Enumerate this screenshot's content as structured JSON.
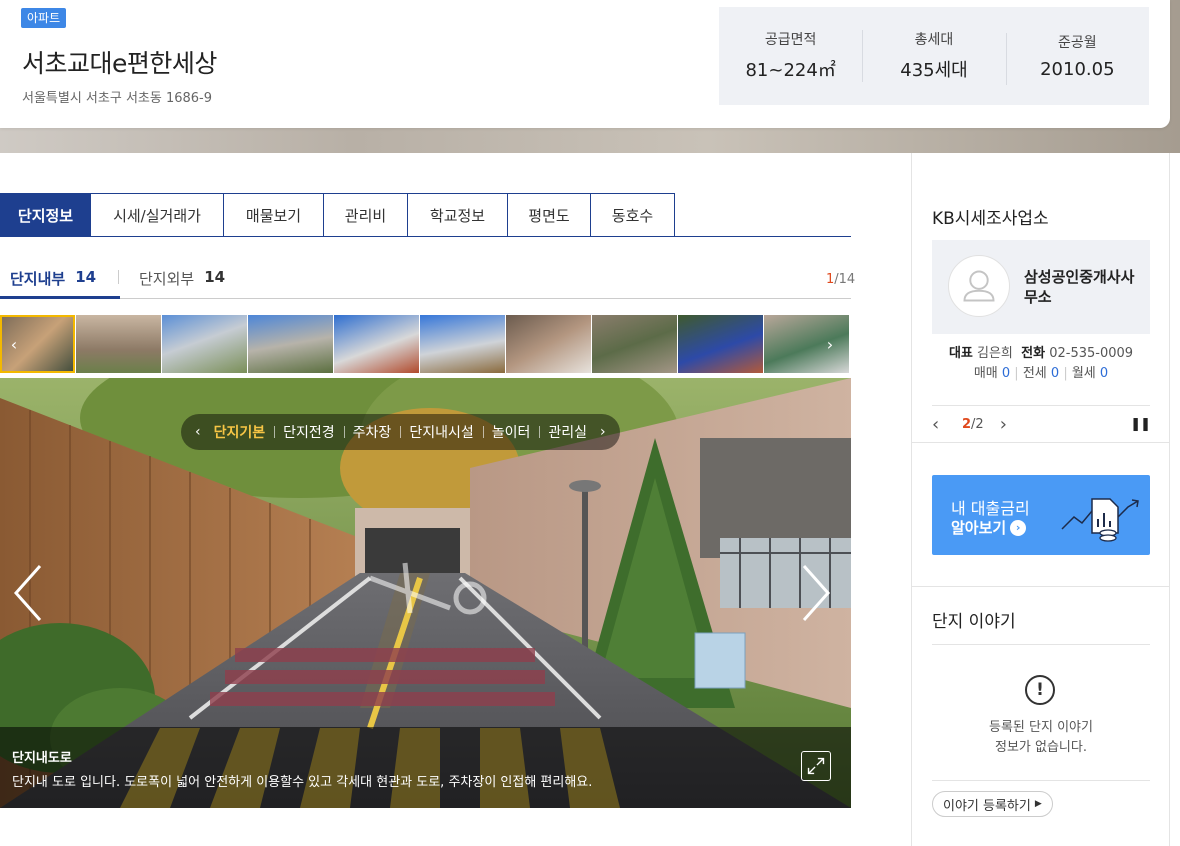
{
  "header": {
    "badge": "아파트",
    "name": "서초교대e편한세상",
    "address": "서울특별시 서초구 서초동 1686-9",
    "stats": [
      {
        "label": "공급면적",
        "value": "81~224㎡"
      },
      {
        "label": "총세대",
        "value": "435세대"
      },
      {
        "label": "준공월",
        "value": "2010.05"
      }
    ]
  },
  "tabs": [
    "단지정보",
    "시세/실거래가",
    "매물보기",
    "관리비",
    "학교정보",
    "평면도",
    "동호수"
  ],
  "subtabs": {
    "inner": {
      "label": "단지내부",
      "count": "14"
    },
    "outer": {
      "label": "단지외부",
      "count": "14"
    }
  },
  "counter": {
    "current": "1",
    "total": "/14"
  },
  "photo": {
    "categories": [
      "단지기본",
      "단지전경",
      "주차장",
      "단지내시설",
      "놀이터",
      "관리실"
    ],
    "caption_title": "단지내도로",
    "caption_desc": "단지내 도로 입니다. 도로폭이 넓어 안전하게 이용할수 있고 각세대 현관과 도로, 주차장이 인접해 편리해요."
  },
  "right_panel": {
    "title": "KB시세조사업소",
    "agent_name": "삼성공인중개사사무소",
    "rep_label": "대표",
    "rep_name": "김은희",
    "phone_label": "전화",
    "phone": "02-535-0009",
    "sale_label": "매매",
    "sale_count": "0",
    "jeonse_label": "전세",
    "jeonse_count": "0",
    "monthly_label": "월세",
    "monthly_count": "0",
    "pager_current": "2",
    "pager_total": "/2",
    "loan_line1": "내 대출금리",
    "loan_line2": "알아보기",
    "story_title": "단지 이야기",
    "story_empty_line1": "등록된 단지 이야기",
    "story_empty_line2": "정보가 없습니다.",
    "story_button": "이야기 등록하기"
  },
  "colors": {
    "primary": "#1e3f8f",
    "badge": "#3d87e6",
    "banner": "#4a9af5",
    "highlight": "#e0491d",
    "category_active": "#f6c545"
  }
}
